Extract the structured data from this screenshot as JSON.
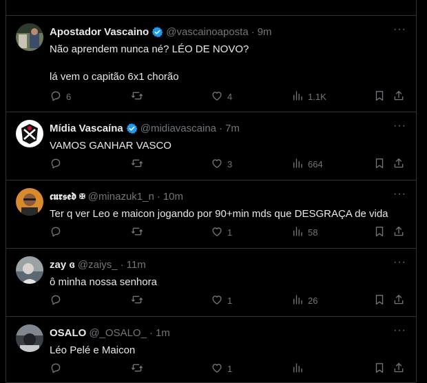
{
  "colors": {
    "background": "#000000",
    "text": "#e7e9ea",
    "muted": "#71767b",
    "border": "#2f3336",
    "verified": "#1d9bf0"
  },
  "posts": [
    {
      "name": "Apostador Vascaino",
      "verified": true,
      "handle": "@vascainoaposta",
      "dot": "·",
      "time": "9m",
      "text1": "Não aprendem nunca né? LÉO DE NOVO?",
      "text2": "lá vem o capitão 6x1 chorão",
      "replies": "6",
      "reposts": "",
      "likes": "4",
      "views": "1.1K"
    },
    {
      "name": "Mídia Vascaína",
      "verified": true,
      "handle": "@midiavascaina",
      "dot": "·",
      "time": "7m",
      "text1": "VAMOS GANHAR VASCO",
      "text2": "",
      "replies": "",
      "reposts": "",
      "likes": "3",
      "views": "664"
    },
    {
      "name": "𝖈𝖚𝖗𝖘𝖊𝖉 ✠",
      "verified": false,
      "handle": "@minazuk1_n",
      "dot": "·",
      "time": "10m",
      "text1": "Ter q ver Leo e maicon jogando por 90+min mds que DESGRAÇA de vida",
      "text2": "",
      "replies": "",
      "reposts": "",
      "likes": "1",
      "views": "58"
    },
    {
      "name": "zay ɞ",
      "verified": false,
      "handle": "@zaiys_",
      "dot": "·",
      "time": "11m",
      "text1": "ô minha nossa senhora",
      "text2": "",
      "replies": "",
      "reposts": "",
      "likes": "1",
      "views": "26"
    },
    {
      "name": "OSALO",
      "verified": false,
      "handle": "@_OSALO_",
      "dot": "·",
      "time": "1m",
      "text1": "Léo Pelé e Maicon",
      "text2": "",
      "replies": "",
      "reposts": "",
      "likes": "1",
      "views": ""
    }
  ],
  "icons": {
    "more": "more-icon",
    "reply": "reply-icon",
    "repost": "repost-icon",
    "like": "heart-icon",
    "views": "views-icon",
    "bookmark": "bookmark-icon",
    "share": "share-icon",
    "verified": "verified-badge-icon"
  },
  "more_glyph": "···"
}
